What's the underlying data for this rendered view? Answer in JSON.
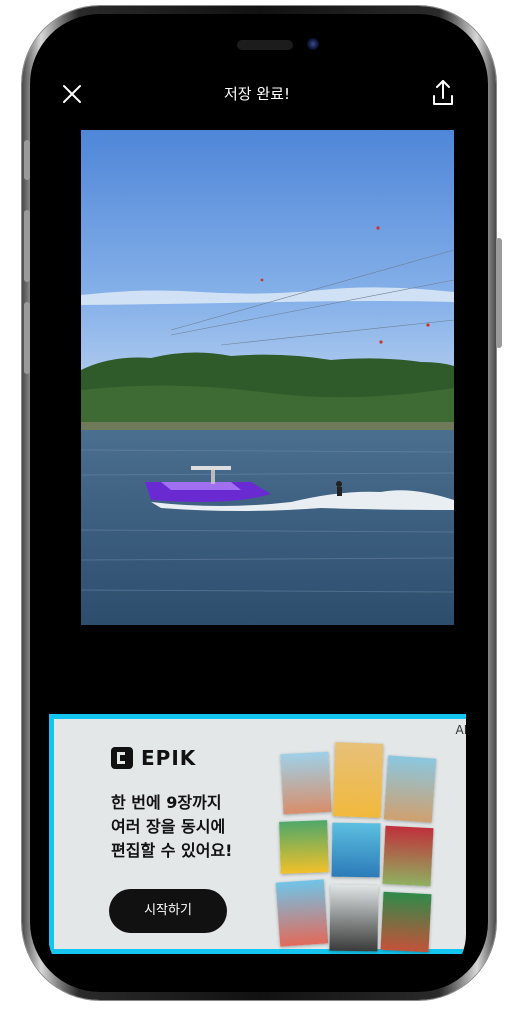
{
  "header": {
    "title": "저장 완료!",
    "close_icon": "close-icon",
    "share_icon": "share-icon"
  },
  "photo": {
    "description_icon": "saved-photo"
  },
  "ad": {
    "tag": "AD",
    "brand": "EPIK",
    "copy": [
      "한 번에 9장까지",
      "여러 장을 동시에",
      "편집할 수 있어요!"
    ],
    "cta_label": "시작하기",
    "accent_color": "#14c6ef"
  }
}
